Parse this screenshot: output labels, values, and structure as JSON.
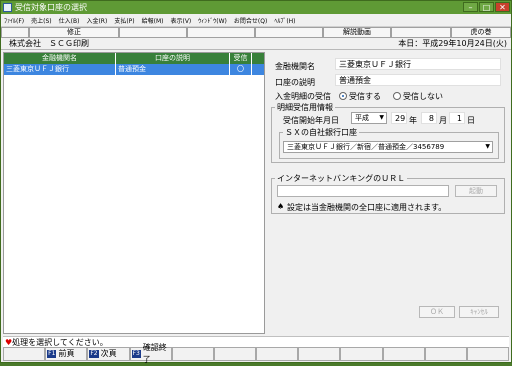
{
  "window": {
    "title": "受信対象口座の選択"
  },
  "menu": [
    "ﾌｧｲﾙ(F)",
    "売上(S)",
    "仕入(B)",
    "入金(R)",
    "支払(P)",
    "給報(M)",
    "表示(V)",
    "ｳｨﾝﾄﾞｳ(W)",
    "お問合せ(Q)",
    "ﾍﾙﾌﾟ(H)"
  ],
  "toolbar": {
    "edit": "修正",
    "video": "解説動画",
    "tora": "虎の巻"
  },
  "info": {
    "company": "株式会社　ＳＣＧ印刷",
    "date": "本日：平成29年10月24日(火)"
  },
  "table": {
    "headers": [
      "金融機関名",
      "口座の説明",
      "受信"
    ],
    "rows": [
      {
        "bank": "三菱東京ＵＦＪ銀行",
        "desc": "普通預金",
        "recv": "〇"
      }
    ]
  },
  "detail": {
    "bank_label": "金融機関名",
    "bank_value": "三菱東京ＵＦＪ銀行",
    "desc_label": "口座の説明",
    "desc_value": "普通預金",
    "recv_label": "入金明細の受信",
    "recv_on": "受信する",
    "recv_off": "受信しない",
    "stmt_label": "明細受信用情報",
    "start_label": "受信開始年月日",
    "era": "平成",
    "year": "29",
    "year_unit": "年",
    "month": "8",
    "month_unit": "月",
    "day": "1",
    "day_unit": "日",
    "sx_label": "ＳＸの自社銀行口座",
    "sx_value": "三菱東京ＵＦＪ銀行／新宿／普通預金／3456789",
    "ib_label": "インターネットバンキングのＵＲＬ",
    "ib_value": "",
    "launch": "起動",
    "note": "設定は当金融機関の全口座に適用されます。",
    "ok": "ＯＫ",
    "cancel": "ｷｬﾝｾﾙ"
  },
  "status": "処理を選択してください。",
  "fkeys": [
    {
      "key": "",
      "label": ""
    },
    {
      "key": "F1",
      "label": "前頁"
    },
    {
      "key": "F2",
      "label": "次頁"
    },
    {
      "key": "F3",
      "label": "確認終了"
    },
    {
      "key": "",
      "label": ""
    },
    {
      "key": "",
      "label": ""
    },
    {
      "key": "",
      "label": ""
    },
    {
      "key": "",
      "label": ""
    },
    {
      "key": "",
      "label": ""
    },
    {
      "key": "",
      "label": ""
    },
    {
      "key": "",
      "label": ""
    },
    {
      "key": "",
      "label": ""
    }
  ]
}
